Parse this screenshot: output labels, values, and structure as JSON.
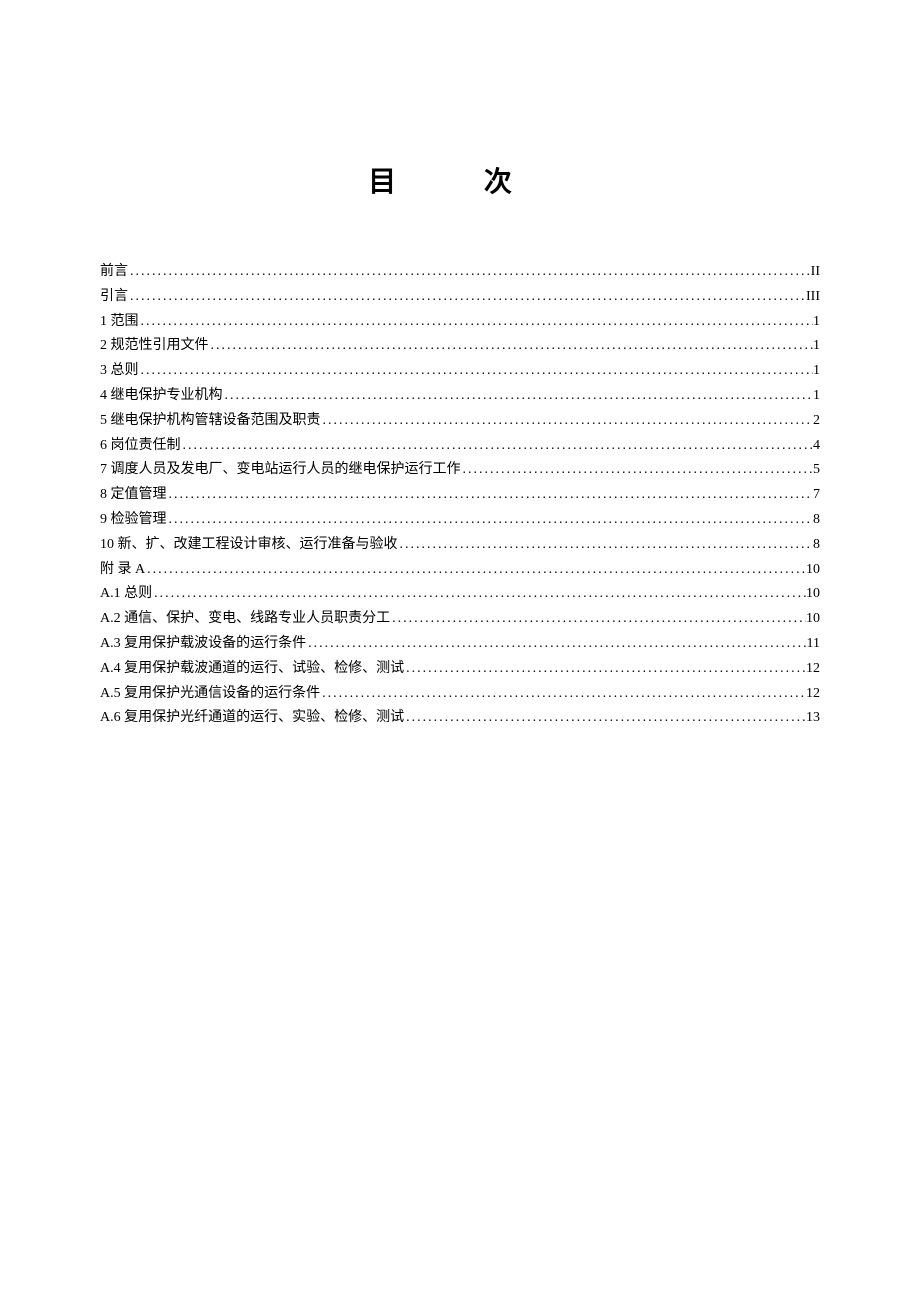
{
  "title": "目 次",
  "toc": [
    {
      "label": "前言",
      "page": "II"
    },
    {
      "label": "引言",
      "page": "III"
    },
    {
      "label": "1 范围",
      "page": "1"
    },
    {
      "label": "2 规范性引用文件",
      "page": "1"
    },
    {
      "label": "3 总则",
      "page": "1"
    },
    {
      "label": "4 继电保护专业机构",
      "page": "1"
    },
    {
      "label": "5 继电保护机构管辖设备范围及职责",
      "page": "2"
    },
    {
      "label": "6 岗位责任制",
      "page": "4"
    },
    {
      "label": "7 调度人员及发电厂、变电站运行人员的继电保护运行工作",
      "page": "5"
    },
    {
      "label": "8 定值管理",
      "page": "7"
    },
    {
      "label": "9 检验管理",
      "page": "8"
    },
    {
      "label": "10 新、扩、改建工程设计审核、运行准备与验收",
      "page": "8"
    },
    {
      "label": "附  录  A",
      "page": "10"
    },
    {
      "label": "A.1 总则",
      "page": "10"
    },
    {
      "label": "A.2 通信、保护、变电、线路专业人员职责分工",
      "page": "10"
    },
    {
      "label": "A.3 复用保护载波设备的运行条件",
      "page": "11"
    },
    {
      "label": "A.4 复用保护载波通道的运行、试验、检修、测试",
      "page": "12"
    },
    {
      "label": "A.5 复用保护光通信设备的运行条件",
      "page": "12"
    },
    {
      "label": "A.6 复用保护光纤通道的运行、实验、检修、测试",
      "page": "13"
    }
  ]
}
